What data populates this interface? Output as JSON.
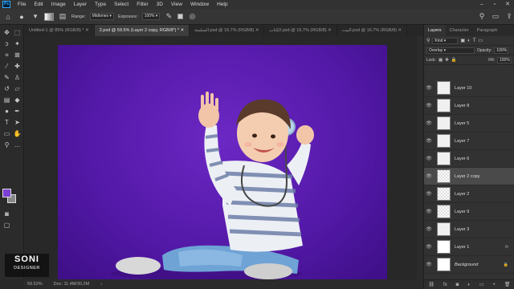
{
  "menubar": {
    "logo": "Ps",
    "items": [
      "File",
      "Edit",
      "Image",
      "Layer",
      "Type",
      "Select",
      "Filter",
      "3D",
      "View",
      "Window",
      "Help"
    ]
  },
  "options": {
    "range_label": "Range:",
    "range_value": "Midtones",
    "exposure_label": "Exposure:",
    "exposure_value": "100%"
  },
  "tabs": [
    "Untitled-1 @ 85% (RGB/8) *",
    "2.psd @ 59.5% (Layer 2 copy, RGB/8*) *",
    "السلسة.psd @ 16.7% (RGB/8)",
    "الكتاب.psd @ 16.7% (RGB/8)",
    "البيت.psd @ 16.7% (RGB/8)"
  ],
  "status": {
    "zoom": "59.52%",
    "doc": "Doc: 11.4M/30.2M"
  },
  "panel": {
    "tabs": [
      "Layers",
      "Character",
      "Paragraph"
    ],
    "kind": "Kind",
    "blend": "Overlay",
    "opacity_label": "Opacity:",
    "opacity_value": "100%",
    "lock_label": "Lock:",
    "fill_label": "Fill:",
    "fill_value": "100%",
    "layers": [
      {
        "name": "Layer 10"
      },
      {
        "name": "Layer 8"
      },
      {
        "name": "Layer 5"
      },
      {
        "name": "Layer 7"
      },
      {
        "name": "Layer 6"
      },
      {
        "name": "Layer 2 copy"
      },
      {
        "name": "Layer 2"
      },
      {
        "name": "Layer 9"
      },
      {
        "name": "Layer 3"
      },
      {
        "name": "Layer 1"
      },
      {
        "name": "Background"
      }
    ]
  },
  "watermark": {
    "brand": "SONI",
    "sub": "DESIGNER"
  },
  "colors": {
    "foreground": "#7c3fd4",
    "background": "#888888",
    "canvas_purple": "#5a1cb0"
  }
}
